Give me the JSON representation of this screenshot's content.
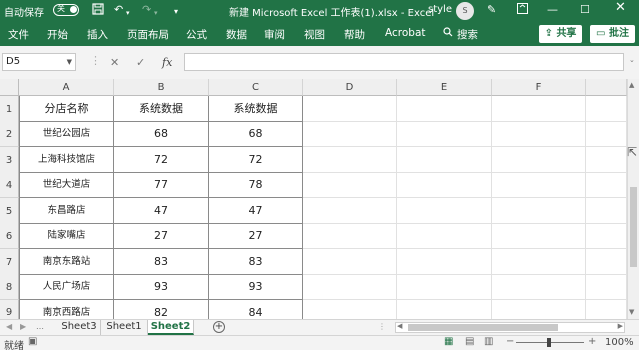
{
  "titlebar": {
    "autosave_label": "自动保存",
    "toggle_state": "关",
    "doc_title": "新建 Microsoft Excel 工作表(1).xlsx  -  Excel",
    "user_name": "style",
    "avatar_initial": "S",
    "accent_color": "#217346"
  },
  "menu": {
    "items": [
      "文件",
      "开始",
      "插入",
      "页面布局",
      "公式",
      "数据",
      "审阅",
      "视图",
      "帮助",
      "Acrobat"
    ],
    "search_label": "搜索",
    "share_label": "共享",
    "comment_label": "批注"
  },
  "formula_bar": {
    "name_box": "D5",
    "fx_label": "fx",
    "formula_value": ""
  },
  "grid": {
    "columns": [
      "A",
      "B",
      "C",
      "D",
      "E",
      "F"
    ],
    "rows": [
      "1",
      "2",
      "3",
      "4",
      "5",
      "6",
      "7",
      "8",
      "9"
    ],
    "header": [
      "分店名称",
      "系统数据",
      "系统数据"
    ],
    "data": [
      [
        "世纪公园店",
        "68",
        "68"
      ],
      [
        "上海科技馆店",
        "72",
        "72"
      ],
      [
        "世纪大道店",
        "77",
        "78"
      ],
      [
        "东昌路店",
        "47",
        "47"
      ],
      [
        "陆家嘴店",
        "27",
        "27"
      ],
      [
        "南京东路站",
        "83",
        "83"
      ],
      [
        "人民广场店",
        "93",
        "93"
      ],
      [
        "南京西路店",
        "82",
        "84"
      ]
    ]
  },
  "sheets": {
    "tabs": [
      "Sheet3",
      "Sheet1",
      "Sheet2"
    ],
    "active": "Sheet2"
  },
  "status": {
    "ready": "就绪",
    "zoom": "100%"
  }
}
